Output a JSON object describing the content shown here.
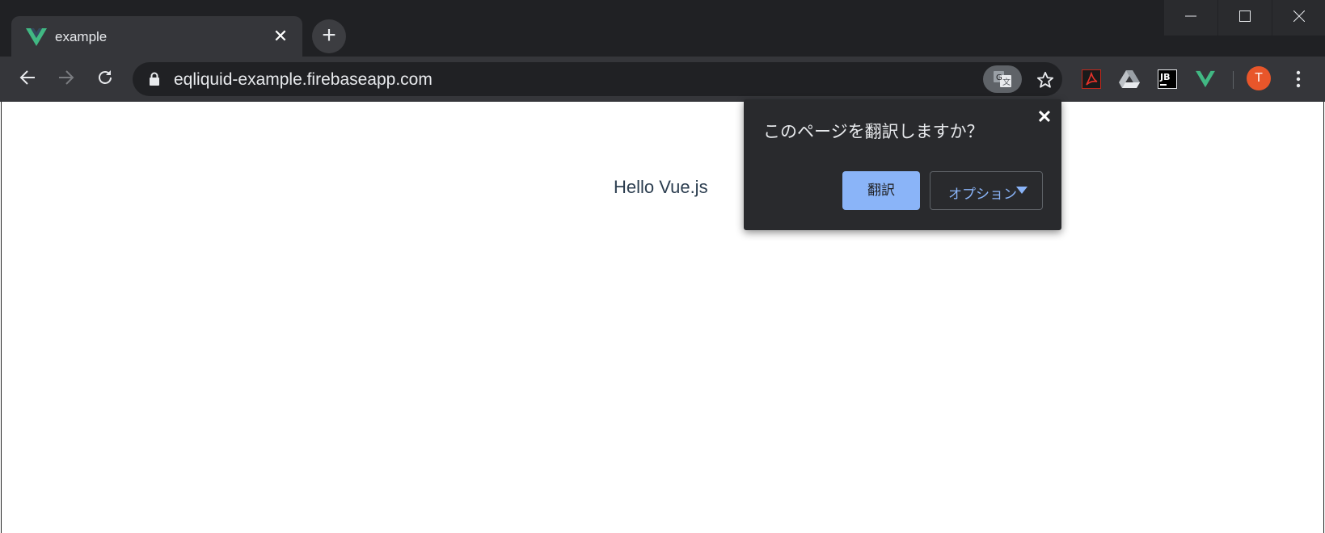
{
  "browser": {
    "tab": {
      "title": "example",
      "close_glyph": "✕",
      "favicon": "vue-logo-icon"
    },
    "new_tab_glyph": "+",
    "window_controls": [
      "minimize-icon",
      "maximize-icon",
      "close-icon"
    ],
    "nav_icons": [
      "back-arrow-icon",
      "forward-arrow-icon",
      "reload-icon"
    ],
    "omnibox": {
      "url": "eqliquid-example.firebaseapp.com",
      "lock_icon": "lock-icon"
    },
    "extensions": [
      "acrobat-icon",
      "google-drive-icon",
      "jetbrains-icon",
      "vue-devtools-icon"
    ],
    "profile": {
      "initial": "T",
      "color": "#e8562a"
    },
    "menu_icon": "kebab-menu-icon"
  },
  "page": {
    "greeting": "Hello Vue.js"
  },
  "translate_popup": {
    "question": "このページを翻訳しますか？",
    "close_glyph": "✕",
    "translate_label": "翻訳",
    "options_label": "オプション",
    "accent_color": "#8ab4f8"
  }
}
